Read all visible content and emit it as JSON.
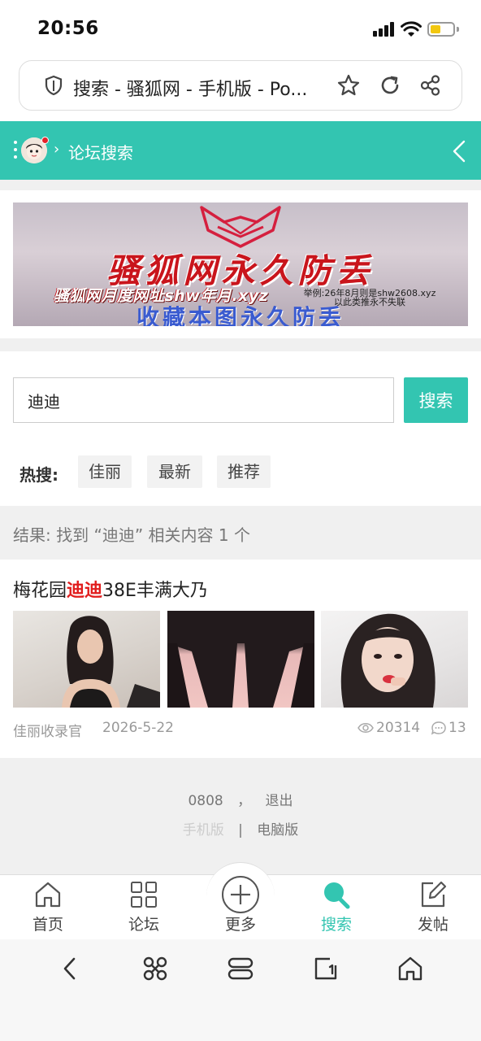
{
  "status": {
    "time": "20:56"
  },
  "browser": {
    "url_text": "搜索 - 骚狐网 - 手机版 - Po..."
  },
  "header": {
    "title": "论坛搜索"
  },
  "banner": {
    "title": "骚狐网永久防丢",
    "url_line": "骚狐网月度网址shw年月.xyz",
    "note_line1": "举例:26年8月则是shw2608.xyz",
    "note_line2": "以此类推永不失联",
    "bottom_line": "收藏本图永久防丢"
  },
  "search": {
    "value": "迪迪",
    "button_label": "搜索"
  },
  "hot": {
    "label": "热搜:",
    "tags": [
      "佳丽",
      "最新",
      "推荐"
    ]
  },
  "result_summary": "结果: 找到 “迪迪” 相关内容 1 个",
  "result_item": {
    "title_before": "梅花园",
    "title_highlight": "迪迪",
    "title_after": "38E丰满大乃",
    "author": "佳丽收录官",
    "date": "2026-5-22",
    "views": "20314",
    "replies": "13"
  },
  "footer": {
    "user": "0808",
    "comma": "，",
    "logout": "退出",
    "mobile": "手机版",
    "divider": "|",
    "desktop": "电脑版"
  },
  "tabs": [
    {
      "label": "首页",
      "icon": "home-icon"
    },
    {
      "label": "论坛",
      "icon": "grid-icon"
    },
    {
      "label": "更多",
      "icon": "plus-circle-icon"
    },
    {
      "label": "搜索",
      "icon": "search-icon",
      "active": true
    },
    {
      "label": "发帖",
      "icon": "compose-icon"
    }
  ],
  "colors": {
    "accent": "#33c5b1",
    "highlight": "#e11d1d"
  }
}
